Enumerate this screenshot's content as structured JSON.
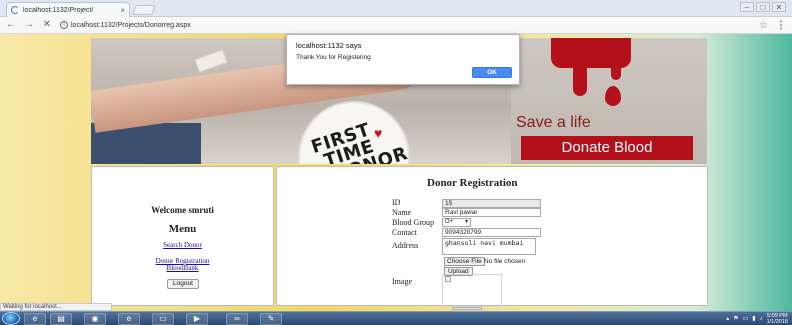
{
  "browser": {
    "tab_title": "localhost:1132/Project/",
    "tab_close": "×",
    "url": "localhost:1132/Projects/Donorreg.aspx",
    "back": "←",
    "forward": "→",
    "reload": "✕",
    "star": "☆",
    "menu": "⋮",
    "window_buttons": [
      "–",
      "□",
      "✕"
    ],
    "status_text": "Waiting for localhost..."
  },
  "banner": {
    "badge_lines": [
      "FIRST",
      "TIME",
      "DONOR"
    ],
    "slogan": "Save a life",
    "cta": "Donate Blood",
    "accent_color": "#b3101a"
  },
  "sidebar": {
    "welcome": "Welcome smruti",
    "menu_title": "Menu",
    "links": [
      "Search Donor",
      "Donor Registration",
      "BloodBank"
    ],
    "logout_label": "Logout"
  },
  "form": {
    "title": "Donor Registration",
    "labels": {
      "id": "ID",
      "name": "Name",
      "blood_group": "Blood Group",
      "contact": "Contact",
      "address": "Address",
      "image": "Image"
    },
    "values": {
      "id": "15",
      "name": "Ravi pawar",
      "blood_group": "O+",
      "contact": "9094320799",
      "address": "ghansoli navi mumbai"
    },
    "choose_file_label": "Choose File",
    "file_status": "No file chosen",
    "upload_label": "Upload"
  },
  "dialog": {
    "title": "localhost:1132 says",
    "message": "Thank You for Registering",
    "ok_label": "OK"
  },
  "taskbar": {
    "clock_time": "5:09 PM",
    "clock_date": "1/1/2018"
  }
}
